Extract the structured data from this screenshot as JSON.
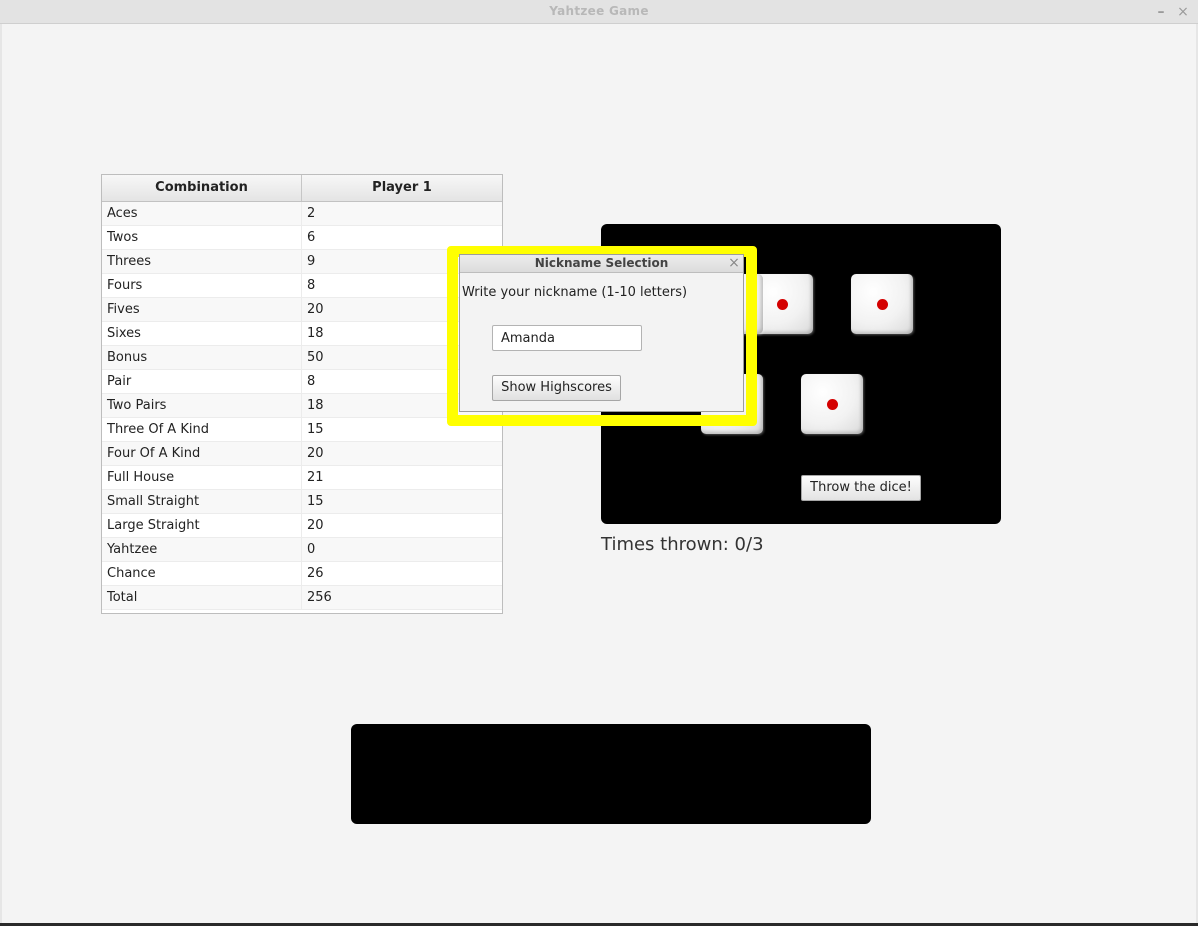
{
  "window": {
    "title": "Yahtzee Game",
    "minimize_glyph": "–",
    "close_glyph": "×"
  },
  "score_table": {
    "columns": [
      "Combination",
      "Player 1"
    ],
    "rows": [
      [
        "Aces",
        "2"
      ],
      [
        "Twos",
        "6"
      ],
      [
        "Threes",
        "9"
      ],
      [
        "Fours",
        "8"
      ],
      [
        "Fives",
        "20"
      ],
      [
        "Sixes",
        "18"
      ],
      [
        "Bonus",
        "50"
      ],
      [
        "Pair",
        "8"
      ],
      [
        "Two Pairs",
        "18"
      ],
      [
        "Three Of A Kind",
        "15"
      ],
      [
        "Four Of A Kind",
        "20"
      ],
      [
        "Full House",
        "21"
      ],
      [
        "Small Straight",
        "15"
      ],
      [
        "Large Straight",
        "20"
      ],
      [
        "Yahtzee",
        "0"
      ],
      [
        "Chance",
        "26"
      ],
      [
        "Total",
        "256"
      ]
    ]
  },
  "dice": [
    {
      "face": 1
    },
    {
      "face": 1
    },
    {
      "face": 1
    },
    {
      "face": 1
    },
    {
      "face": 1
    }
  ],
  "throw_button": "Throw the dice!",
  "times_thrown": "Times thrown: 0/3",
  "dialog": {
    "title": "Nickname Selection",
    "close_glyph": "×",
    "prompt": "Write your nickname (1-10 letters)",
    "nickname_value": "Amanda",
    "highscores_button": "Show Highscores",
    "highlight_color": "#ffff00"
  },
  "colors": {
    "pip": "#d40000",
    "board": "#000000"
  }
}
